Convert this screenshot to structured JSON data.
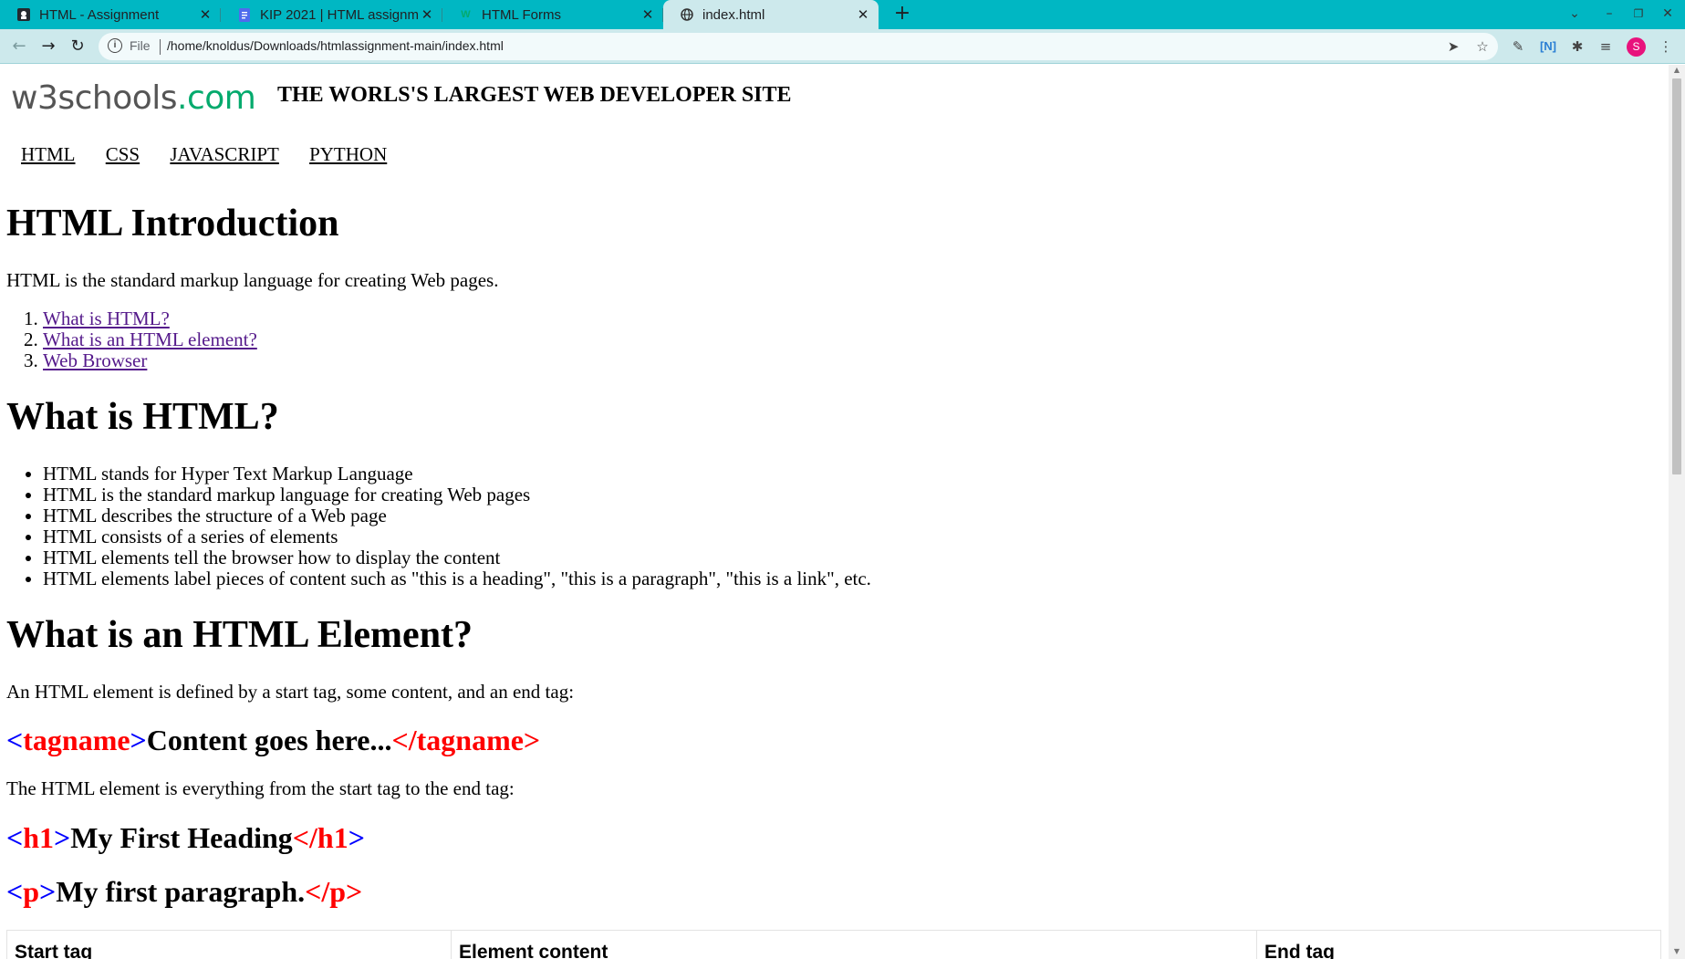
{
  "browser": {
    "tabs": [
      {
        "title": "HTML - Assignment",
        "favicon": "github-icon",
        "active": false
      },
      {
        "title": "KIP 2021 | HTML assignme",
        "favicon": "docs-icon",
        "active": false
      },
      {
        "title": "HTML Forms",
        "favicon": "w3schools-icon",
        "active": false
      },
      {
        "title": "index.html",
        "favicon": "globe-icon",
        "active": true
      }
    ],
    "omnibox": {
      "scheme_label": "File",
      "url": "/home/knoldus/Downloads/htmlassignment-main/index.html"
    },
    "profile_initial": "S"
  },
  "colors": {
    "tabbar": "#00b7c3",
    "toolbar": "#cde9ec",
    "logo_green": "#04aa6d",
    "tag_bracket": "#0000ff",
    "tag_name": "#ff0000",
    "link": "#551a8b"
  },
  "header": {
    "logo_main": "w3schools",
    "logo_suffix": ".com",
    "tagline": "THE WORLS'S LARGEST WEB DEVELOPER SITE"
  },
  "nav": [
    "HTML",
    "CSS",
    "JAVASCRIPT",
    "PYTHON"
  ],
  "intro": {
    "title": "HTML Introduction",
    "text": "HTML is the standard markup language for creating Web pages.",
    "toc": [
      "What is HTML?",
      "What is an HTML element?",
      "Web Browser"
    ]
  },
  "what_is": {
    "title": "What is HTML?",
    "bullets": [
      "HTML stands for Hyper Text Markup Language",
      "HTML is the standard markup language for creating Web pages",
      "HTML describes the structure of a Web page",
      "HTML consists of a series of elements",
      "HTML elements tell the browser how to display the content",
      "HTML elements label pieces of content such as \"this is a heading\", \"this is a paragraph\", \"this is a link\", etc."
    ]
  },
  "element": {
    "title": "What is an HTML Element?",
    "text1": "An HTML element is defined by a start tag, some content, and an end tag:",
    "example1": {
      "tag": "tagname",
      "content": "Content goes here..."
    },
    "text2": "The HTML element is everything from the start tag to the end tag:",
    "example2": {
      "tag": "h1",
      "content": "My First Heading"
    },
    "example3": {
      "tag": "p",
      "content": "My first paragraph."
    }
  },
  "table": {
    "headers": [
      "Start tag",
      "Element content",
      "End tag"
    ]
  }
}
